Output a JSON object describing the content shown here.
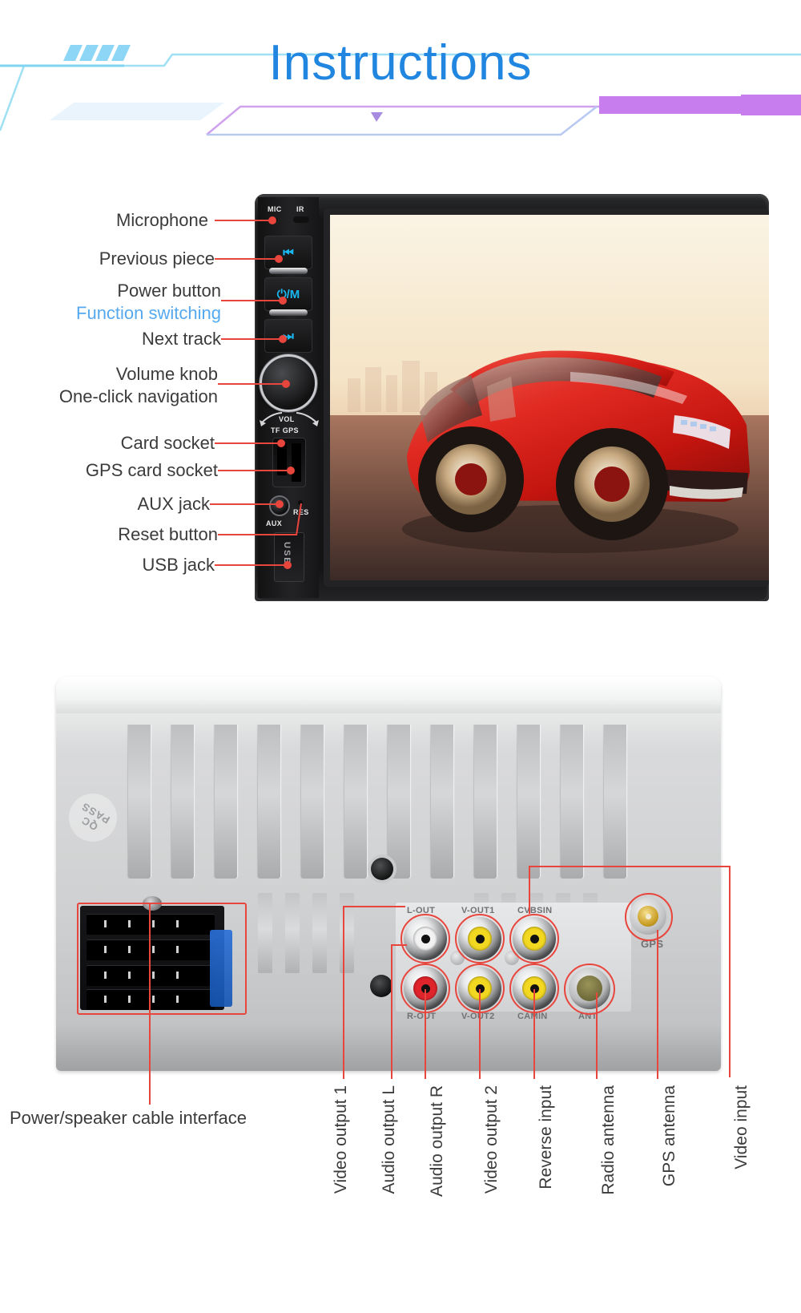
{
  "header": {
    "title": "Instructions",
    "title_color": "#2186e0",
    "accent_cyan": "#7fd4f0",
    "accent_purple": "#c07ae8"
  },
  "front_panel": {
    "device_markings": {
      "mic": "MIC",
      "ir": "IR",
      "prev": "⏮",
      "power": "⏻/M",
      "next": "⏭",
      "vol": "VOL",
      "tf_gps": "TF GPS",
      "aux": "AUX",
      "res": "RES",
      "usb": "USB"
    },
    "callouts": [
      {
        "label": "Microphone",
        "blue": false
      },
      {
        "label": "Previous piece",
        "blue": false
      },
      {
        "label": "Power button",
        "blue": false
      },
      {
        "label": "Function switching",
        "blue": true
      },
      {
        "label": "Next track",
        "blue": false
      },
      {
        "label": "Volume knob",
        "blue": false
      },
      {
        "label": "One-click navigation",
        "blue": false
      },
      {
        "label": "Card socket",
        "blue": false
      },
      {
        "label": "GPS card socket",
        "blue": false
      },
      {
        "label": "AUX jack",
        "blue": false
      },
      {
        "label": "Reset button",
        "blue": false
      },
      {
        "label": "USB jack",
        "blue": false
      }
    ],
    "screen_content": "red sports car on road at sunset"
  },
  "rear_panel": {
    "qc_stamp": "QC PASS",
    "port_markings_top": [
      "L-OUT",
      "V-OUT1",
      "CVBSIN"
    ],
    "port_markings_bottom": [
      "R-OUT",
      "V-OUT2",
      "CAMIN",
      "ANT"
    ],
    "gps_marking": "GPS",
    "callouts": [
      {
        "label": "Power/speaker cable interface",
        "orientation": "horizontal"
      },
      {
        "label": "Video output 1",
        "orientation": "vertical"
      },
      {
        "label": "Audio output L",
        "orientation": "vertical"
      },
      {
        "label": "Audio output R",
        "orientation": "vertical"
      },
      {
        "label": "Video output 2",
        "orientation": "vertical"
      },
      {
        "label": "Reverse input",
        "orientation": "vertical"
      },
      {
        "label": "Radio antenna",
        "orientation": "vertical"
      },
      {
        "label": "GPS antenna",
        "orientation": "vertical"
      },
      {
        "label": "Video input",
        "orientation": "vertical"
      }
    ]
  },
  "colors": {
    "leader_red": "#e8453c",
    "text_dark": "#3b3b3b",
    "label_blue": "#55a9ef"
  }
}
